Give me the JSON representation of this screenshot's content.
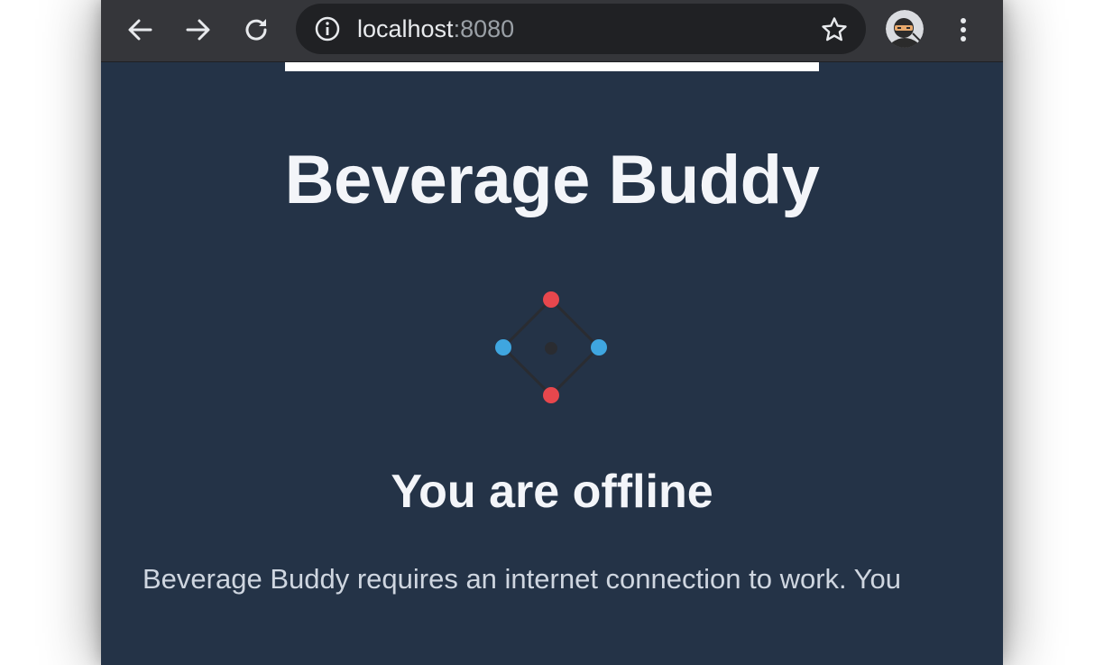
{
  "browser": {
    "url_host": "localhost",
    "url_port": ":8080",
    "icons": {
      "back": "arrow-left-icon",
      "forward": "arrow-right-icon",
      "reload": "reload-icon",
      "site_info": "info-icon",
      "bookmark": "star-icon",
      "profile": "ninja-avatar",
      "menu": "vertical-dots-icon"
    }
  },
  "page": {
    "app_title": "Beverage Buddy",
    "offline_title": "You are offline",
    "offline_message": "Beverage Buddy requires an internet connection to work. You",
    "colors": {
      "background": "#243347",
      "dot_red": "#e8474d",
      "dot_blue": "#3fa6e0",
      "line": "#2c2f36"
    }
  }
}
